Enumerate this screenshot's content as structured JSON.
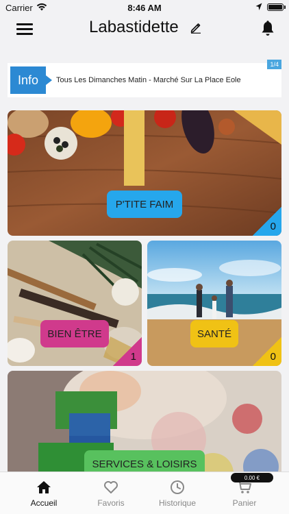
{
  "status_bar": {
    "carrier": "Carrier",
    "time": "8:46 AM"
  },
  "header": {
    "title": "Labastidette"
  },
  "info_banner": {
    "tag": "Info",
    "message": "Tous Les Dimanches Matin - Marché Sur La Place Eole",
    "counter": "1/4"
  },
  "categories": [
    {
      "label": "P'TITE FAIM",
      "count": "0",
      "color": "#26a7ec"
    },
    {
      "label": "BIEN ÊTRE",
      "count": "1",
      "color": "#d03a8c"
    },
    {
      "label": "SANTÉ",
      "count": "0",
      "color": "#f0c215"
    },
    {
      "label": "SERVICES & LOISIRS",
      "color": "#58c15e"
    }
  ],
  "tabbar": {
    "tabs": [
      {
        "label": "Accueil",
        "icon": "home-icon",
        "active": true
      },
      {
        "label": "Favoris",
        "icon": "heart-icon"
      },
      {
        "label": "Historique",
        "icon": "clock-icon"
      },
      {
        "label": "Panier",
        "icon": "cart-icon"
      }
    ],
    "cart_total": "0.00 €"
  }
}
